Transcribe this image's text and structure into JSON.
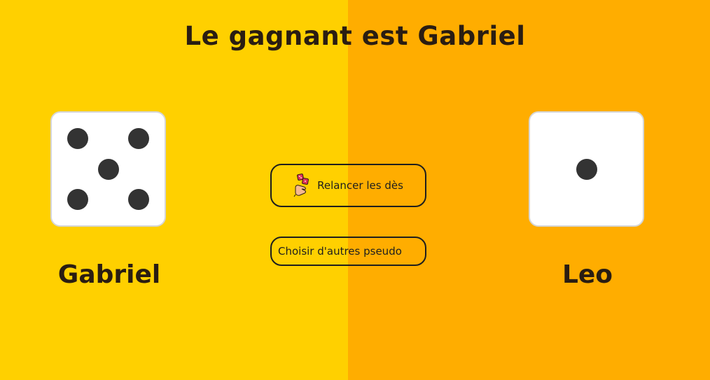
{
  "title": "Le gagnant est Gabriel",
  "players": [
    {
      "name": "Gabriel",
      "die_value": 5
    },
    {
      "name": "Leo",
      "die_value": 1
    }
  ],
  "buttons": {
    "reroll_label": "Relancer les dès",
    "reroll_icon": "hand-throwing-dice-icon",
    "pseudo_label": "Choisir d'autres pseudo"
  },
  "colors": {
    "left_background": "#ffd000",
    "right_background": "#ffad00",
    "text": "#2a1d12",
    "pip": "#333333"
  }
}
